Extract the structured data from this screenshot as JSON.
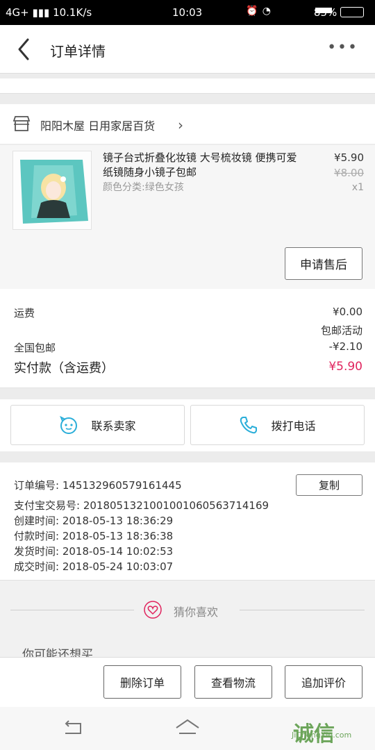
{
  "status_bar": {
    "network": "4G+",
    "speed": "10.1K/s",
    "time": "10:03",
    "battery": "83%"
  },
  "nav": {
    "title": "订单详情",
    "more": "•••"
  },
  "shop": {
    "name": "阳阳木屋 日用家居百货"
  },
  "product": {
    "title": "镜子台式折叠化妆镜 大号梳妆镜 便携可爱纸镜随身小镜子包邮",
    "attr": "颜色分类:绿色女孩",
    "price": "¥5.90",
    "original_price": "¥8.00",
    "qty": "x1",
    "after_sales_button": "申请售后"
  },
  "costs": {
    "shipping_label": "运费",
    "shipping_value": "¥0.00",
    "promo_label": "包邮活动",
    "free_shipping_label": "全国包邮",
    "discount_value": "-¥2.10",
    "total_label": "实付款（含运费）",
    "total_value": "¥5.90"
  },
  "contact": {
    "seller_label": "联系卖家",
    "call_label": "拨打电话"
  },
  "order_info": {
    "order_no_label": "订单编号:",
    "order_no": "145132960579161445",
    "copy_button": "复制",
    "alipay_label": "支付宝交易号:",
    "alipay_no": "2018051321001001060563714169",
    "created_label": "创建时间:",
    "created": "2018-05-13 18:36:29",
    "paid_label": "付款时间:",
    "paid": "2018-05-13 18:36:38",
    "shipped_label": "发货时间:",
    "shipped": "2018-05-14 10:02:53",
    "completed_label": "成交时间:",
    "completed": "2018-05-24 10:03:07"
  },
  "guess": {
    "title": "猜你喜欢",
    "subtitle": "你可能还想买"
  },
  "bottom_actions": {
    "delete": "删除订单",
    "logistics": "查看物流",
    "review": "追加评价"
  },
  "watermark": {
    "brand": "诚信",
    "site": "JiChengXin.com"
  },
  "colors": {
    "price_red": "#e0245e",
    "accent_cyan": "#2aaed9"
  }
}
